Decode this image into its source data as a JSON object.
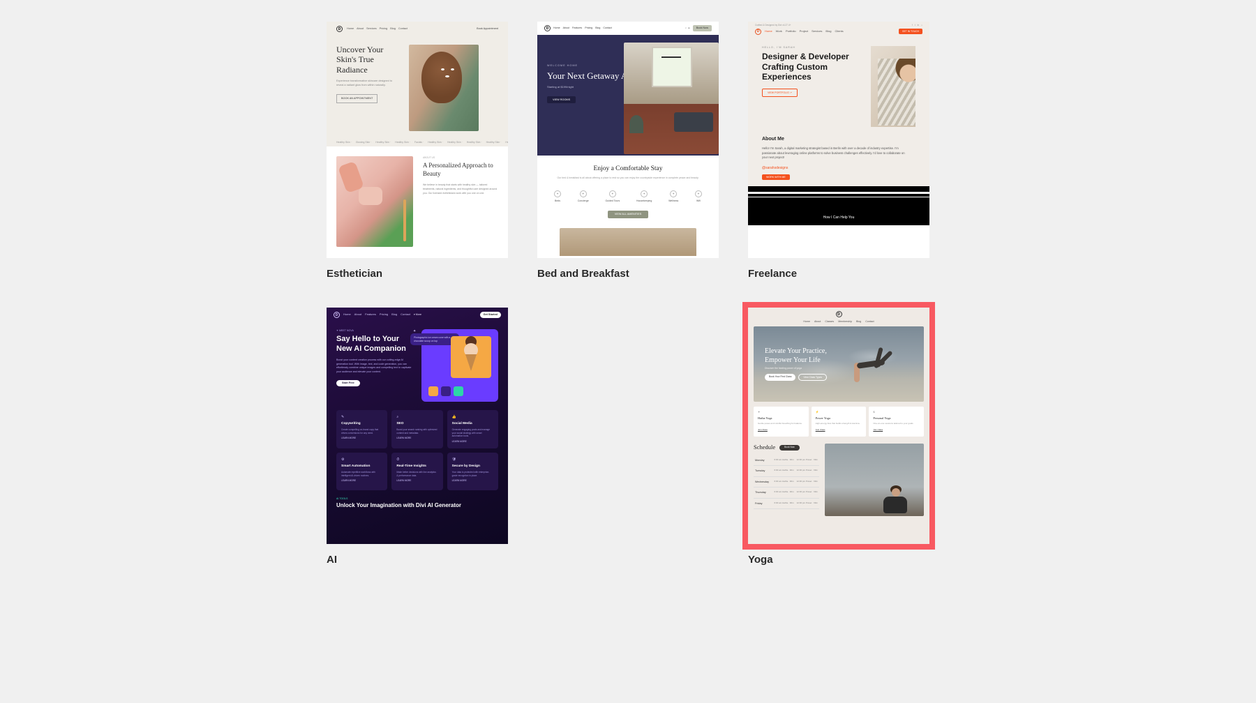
{
  "items": [
    {
      "id": "esthetician",
      "title": "Esthetician",
      "nav": [
        "Home",
        "About",
        "Services",
        "Pricing",
        "Blog",
        "Contact"
      ],
      "nav_right": "Book Appointment",
      "h1": "Uncover Your Skin's True Radiance",
      "sub": "Experience transformative skincare designed to reveal a radiant glow from within naturally.",
      "cta": "BOOK AN APPOINTMENT",
      "ticker": [
        "Healthy Skin",
        "Glowing Skin",
        "Healthy Skin",
        "Healthy Skin",
        "Facials",
        "Healthy Skin",
        "Healthy Skin",
        "Healthy Skin",
        "Healthy Skin",
        "Healthy Skin"
      ],
      "h2": "A Personalized Approach to Beauty",
      "p2": "We believe in beauty that starts with healthy skin — tailored treatments, natural ingredients, and thoughtful care designed around you. Our licensed estheticians work with you one on one."
    },
    {
      "id": "bnb",
      "title": "Bed and Breakfast",
      "nav": [
        "Home",
        "About",
        "Features",
        "Pricing",
        "Blog",
        "Contact"
      ],
      "nav_badge": "Book Now",
      "welcome": "WELCOME HOME",
      "h1": "Your Next Getaway Awaits",
      "sub": "Starting at $199/night",
      "cta": "VIEW ROOMS",
      "h2": "Enjoy a Comfortable Stay",
      "p2": "Our bed & breakfast is all about offering a place to rest so you can enjoy the countryside experience in complete peace and beauty.",
      "amen": [
        "Beds",
        "Concierge",
        "Guided Tours",
        "Housekeeping",
        "Wellness",
        "Wifi"
      ],
      "cta2": "VIEW ALL AMENITIES"
    },
    {
      "id": "freelance",
      "title": "Freelance",
      "topbar_left": "Crafted & Designed by Divi v4.27.4+",
      "topbar_right": [
        "f",
        "t",
        "in",
        "⌂"
      ],
      "nav": [
        "Home",
        "Work",
        "Portfolio",
        "Project",
        "Services",
        "Blog",
        "Clients"
      ],
      "nav_btn": "GET IN TOUCH",
      "hi": "HELLO, I'M SARAH",
      "h1": "Designer & Developer Crafting Custom Experiences",
      "cta": "VIEW PORTFOLIO ↗",
      "about_h": "About Me",
      "about_p": "Hello! I'm Sarah, a digital marketing strategist based in Berlin with over a decade of industry expertise. I'm passionate about leveraging online platforms to solve business challenges effectively. I'd love to collaborate on your next project!",
      "handle": "@sarahsdesigns",
      "cta2": "WORK WITH ME",
      "black_h": "How I Can Help You"
    },
    {
      "id": "ai",
      "title": "AI",
      "nav": [
        "Home",
        "About",
        "Features",
        "Pricing",
        "Blog",
        "Contact"
      ],
      "nav_more": "▾ More",
      "nav_btn": "Get Started",
      "hi": "✦ MEET NOVA",
      "h1": "Say Hello to Your New AI Companion",
      "p": "Boost your content creation process with our cutting-edge AI generation tool. With image, text, and code generation, you can effortlessly combine unique images and compelling text to captivate your audience and elevate your content.",
      "cta": "Start Free",
      "chat": "Photographic ice cream cone with a chocolate scoop on top",
      "grid": [
        {
          "icon": "✎",
          "t": "Copywriting",
          "p": "Create compelling on-brand copy that drives conversions for any need."
        },
        {
          "icon": "⌕",
          "t": "SEO",
          "p": "Boost your search ranking with optimized content and metadata."
        },
        {
          "icon": "👍",
          "t": "Social Media",
          "p": "Generate engaging posts and manage your social strategy with smart automation tools."
        },
        {
          "icon": "⚙",
          "t": "Smart Automation",
          "p": "Automate repetitive workflows with intelligent AI-driven routines."
        },
        {
          "icon": "⏱",
          "t": "Real-Time Insights",
          "p": "Make better decisions with live analytics & performance data."
        },
        {
          "icon": "🛡",
          "t": "Secure by Design",
          "p": "Your data is protected with enterprise-grade encryption in place."
        }
      ],
      "link": "LEARN MORE",
      "bt_tag": "AI TOOLS",
      "bt_h": "Unlock Your Imagination with Divi AI Generator"
    },
    {
      "id": "yoga",
      "title": "Yoga",
      "nav": [
        "Home",
        "About",
        "Classes",
        "Membership",
        "Blog",
        "Contact"
      ],
      "h1a": "Elevate Your Practice,",
      "h1b": "Empower Your Life",
      "sub": "Discover the healing power of yoga",
      "b1": "Book Your First Class",
      "b2": "View Class Types",
      "cards": [
        {
          "icon": "✦",
          "t": "Hatha Yoga",
          "p": "Gentle poses and mindful breathing for balance.",
          "link": "Join Class"
        },
        {
          "icon": "⚡",
          "t": "Power Yoga",
          "p": "High-energy flow that builds strength & stamina.",
          "link": "Join Class"
        },
        {
          "icon": "$",
          "t": "Personal Yoga",
          "p": "One-on-one sessions tailored to your goals.",
          "link": "Join Class"
        }
      ],
      "sched_h": "Schedule",
      "sched_btn": "Book Now",
      "days": [
        "Monday",
        "Tuesday",
        "Wednesday",
        "Thursday",
        "Friday"
      ],
      "slot": [
        "6:00 am Hatha · 90m",
        "12:00 pm Power · 60m"
      ]
    }
  ]
}
